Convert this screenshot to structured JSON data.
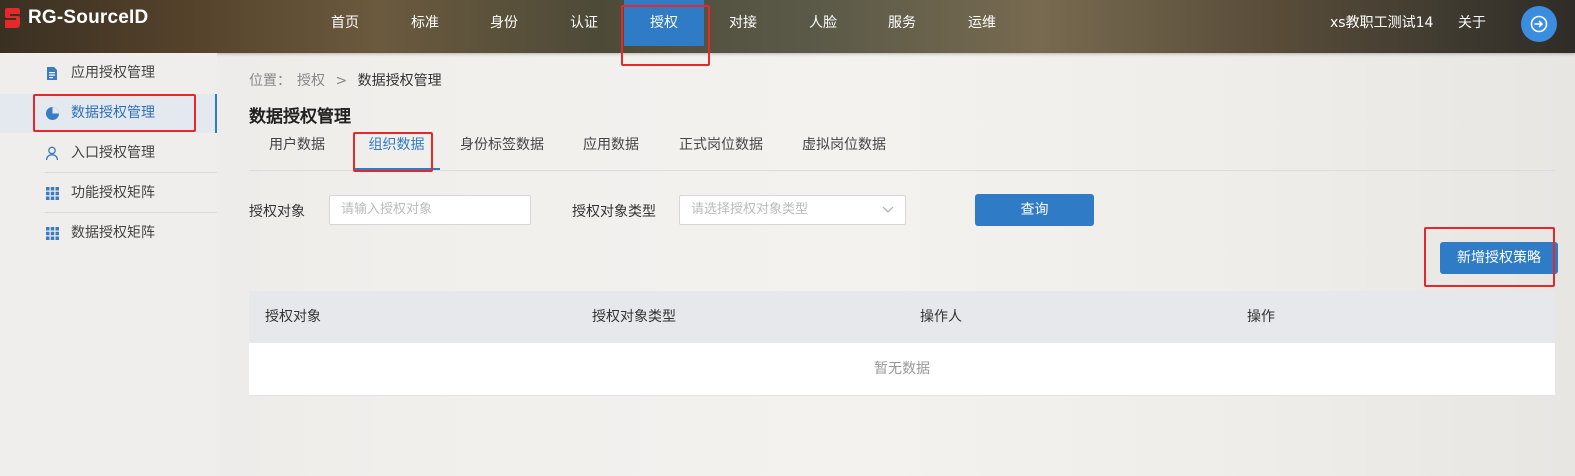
{
  "app": {
    "logo_text": "RG-SourceID",
    "brand_color": "#e5292b",
    "accent_color": "#2f7bc6"
  },
  "header": {
    "nav": [
      {
        "label": "首页"
      },
      {
        "label": "标准"
      },
      {
        "label": "身份"
      },
      {
        "label": "认证"
      },
      {
        "label": "授权",
        "active": true
      },
      {
        "label": "对接"
      },
      {
        "label": "人脸"
      },
      {
        "label": "服务"
      },
      {
        "label": "运维"
      }
    ],
    "user_name": "xs教职工测试14",
    "about_label": "关于",
    "logout_icon": "logout-icon"
  },
  "sidebar": {
    "items": [
      {
        "label": "应用授权管理",
        "icon": "document-icon"
      },
      {
        "label": "数据授权管理",
        "icon": "pie-chart-icon",
        "active": true
      },
      {
        "label": "入口授权管理",
        "icon": "user-icon"
      },
      {
        "label": "功能授权矩阵",
        "icon": "grid-icon"
      },
      {
        "label": "数据授权矩阵",
        "icon": "grid-icon"
      }
    ]
  },
  "breadcrumb": {
    "prefix": "位置：",
    "level1": "授权",
    "separator": ">",
    "current": "数据授权管理"
  },
  "page": {
    "title": "数据授权管理"
  },
  "tabs": [
    {
      "label": "用户数据"
    },
    {
      "label": "组织数据",
      "active": true
    },
    {
      "label": "身份标签数据"
    },
    {
      "label": "应用数据"
    },
    {
      "label": "正式岗位数据"
    },
    {
      "label": "虚拟岗位数据"
    }
  ],
  "filters": {
    "target_label": "授权对象",
    "target_placeholder": "请输入授权对象",
    "type_label": "授权对象类型",
    "type_placeholder": "请选择授权对象类型",
    "query_button": "查询"
  },
  "add_button": "新增授权策略",
  "table": {
    "columns": [
      "授权对象",
      "授权对象类型",
      "操作人",
      "操作"
    ],
    "empty_text": "暂无数据"
  }
}
